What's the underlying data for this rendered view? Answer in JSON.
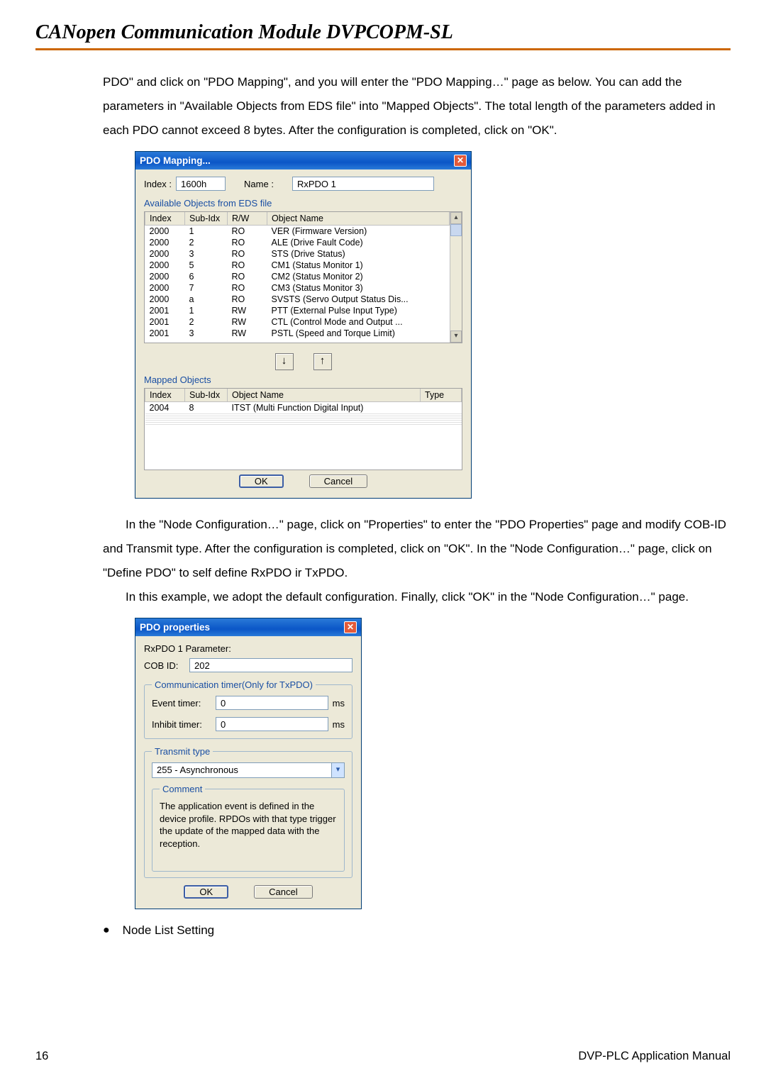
{
  "doc_title": "CANopen Communication Module DVPCOPM-SL",
  "paragraphs": {
    "p1": "PDO\" and click on \"PDO Mapping\", and you will enter the \"PDO Mapping…\" page as below. You can add the parameters in \"Available Objects from EDS file\" into \"Mapped Objects\". The total length of the parameters added in each PDO cannot exceed 8 bytes. After the configuration is completed, click on \"OK\".",
    "p2": "In the \"Node Configuration…\" page, click on \"Properties\" to enter the \"PDO Properties\" page and modify COB-ID and Transmit type. After the configuration is completed, click on \"OK\". In the \"Node Configuration…\" page, click on \"Define PDO\" to self define RxPDO ir TxPDO.",
    "p3": "In this example, we adopt the default configuration. Finally, click \"OK\" in the \"Node Configuration…\" page.",
    "bullet": "Node List Setting"
  },
  "footer": {
    "page": "16",
    "right": "DVP-PLC Application Manual"
  },
  "dlg1": {
    "title": "PDO Mapping...",
    "index_label": "Index :",
    "index_value": "1600h",
    "name_label": "Name :",
    "name_value": "RxPDO 1",
    "avail_label": "Available Objects from EDS file",
    "avail_hdr": {
      "c0": "Index",
      "c1": "Sub-Idx",
      "c2": "R/W",
      "c3": "Object Name"
    },
    "avail_rows": [
      {
        "c0": "2000",
        "c1": "1",
        "c2": "RO",
        "c3": "VER (Firmware Version)"
      },
      {
        "c0": "2000",
        "c1": "2",
        "c2": "RO",
        "c3": "ALE (Drive Fault Code)"
      },
      {
        "c0": "2000",
        "c1": "3",
        "c2": "RO",
        "c3": "STS (Drive Status)"
      },
      {
        "c0": "2000",
        "c1": "5",
        "c2": "RO",
        "c3": "CM1 (Status Monitor 1)"
      },
      {
        "c0": "2000",
        "c1": "6",
        "c2": "RO",
        "c3": "CM2 (Status Monitor 2)"
      },
      {
        "c0": "2000",
        "c1": "7",
        "c2": "RO",
        "c3": "CM3 (Status Monitor 3)"
      },
      {
        "c0": "2000",
        "c1": "a",
        "c2": "RO",
        "c3": "SVSTS (Servo Output Status Dis..."
      },
      {
        "c0": "2001",
        "c1": "1",
        "c2": "RW",
        "c3": "PTT (External Pulse Input Type)"
      },
      {
        "c0": "2001",
        "c1": "2",
        "c2": "RW",
        "c3": "CTL (Control Mode and Output ..."
      },
      {
        "c0": "2001",
        "c1": "3",
        "c2": "RW",
        "c3": "PSTL (Speed and Torque Limit)"
      }
    ],
    "mapped_label": "Mapped Objects",
    "mapped_hdr": {
      "c0": "Index",
      "c1": "Sub-Idx",
      "c2": "Object Name",
      "c3": "Type"
    },
    "mapped_rows": [
      {
        "c0": "2004",
        "c1": "8",
        "c2": "ITST (Multi Function Digital Input)",
        "c3": ""
      }
    ],
    "ok": "OK",
    "cancel": "Cancel"
  },
  "dlg2": {
    "title": "PDO properties",
    "param_label": "RxPDO 1 Parameter:",
    "cobid_label": "COB ID:",
    "cobid_value": "202",
    "group1_legend": "Communication timer(Only for TxPDO)",
    "event_label": "Event timer:",
    "event_value": "0",
    "inhibit_label": "Inhibit timer:",
    "inhibit_value": "0",
    "ms": "ms",
    "group2_legend": "Transmit type",
    "transmit_value": "255 - Asynchronous",
    "comment_legend": "Comment",
    "comment_text": "The application event is defined in the device profile. RPDOs with that type trigger the update of the mapped data with the reception.",
    "ok": "OK",
    "cancel": "Cancel"
  }
}
